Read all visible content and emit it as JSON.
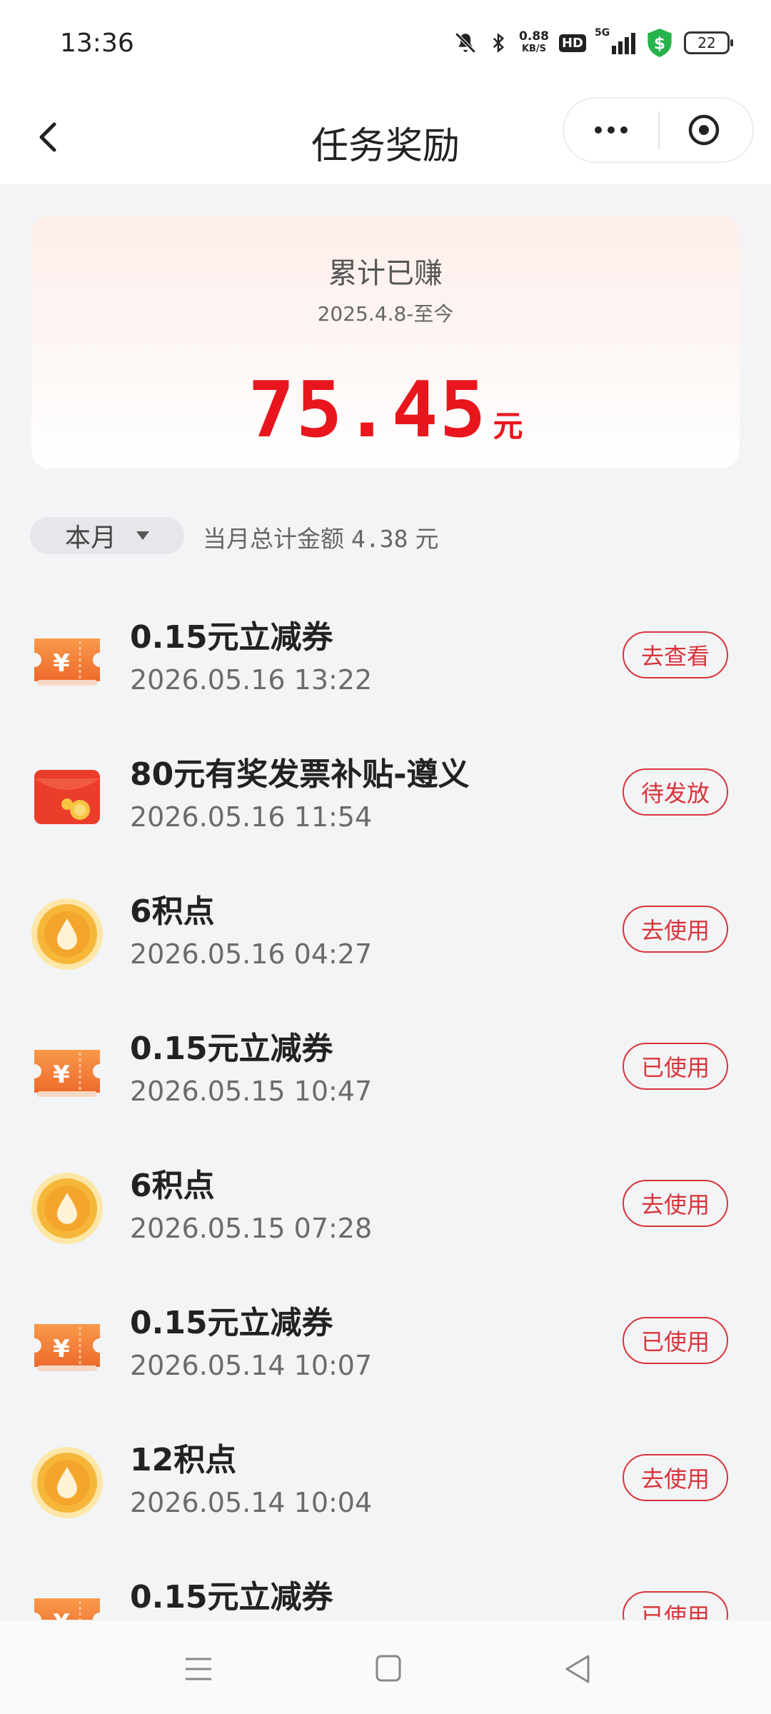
{
  "status_bar": {
    "time": "13:36",
    "speed_value": "0.88",
    "speed_unit": "KB/S",
    "hd_label": "HD",
    "network": "5G",
    "battery": "22",
    "icons": [
      "bell-off-icon",
      "bluetooth-icon",
      "hd-icon",
      "signal-icon",
      "shield-dollar-icon",
      "battery-icon"
    ]
  },
  "nav": {
    "title": "任务奖励",
    "back_icon": "chevron-left-icon",
    "more_icon": "more-dots-icon",
    "close_icon": "close-circle-icon"
  },
  "summary": {
    "title": "累计已赚",
    "range": "2025.4.8-至今",
    "amount": "75.45",
    "unit": "元"
  },
  "filter": {
    "month_label": "本月",
    "total_prefix": "当月总计金额",
    "total_value": "4.38",
    "total_unit": "元"
  },
  "rewards": [
    {
      "icon": "coupon-icon",
      "name": "0.15元立减券",
      "time": "2026.05.16 13:22",
      "action": "去查看"
    },
    {
      "icon": "red-envelope-icon",
      "name": "80元有奖发票补贴-遵义",
      "time": "2026.05.16 11:54",
      "action": "待发放"
    },
    {
      "icon": "points-coin-icon",
      "name": "6积点",
      "time": "2026.05.16 04:27",
      "action": "去使用"
    },
    {
      "icon": "coupon-icon",
      "name": "0.15元立减券",
      "time": "2026.05.15 10:47",
      "action": "已使用"
    },
    {
      "icon": "points-coin-icon",
      "name": "6积点",
      "time": "2026.05.15 07:28",
      "action": "去使用"
    },
    {
      "icon": "coupon-icon",
      "name": "0.15元立减券",
      "time": "2026.05.14 10:07",
      "action": "已使用"
    },
    {
      "icon": "points-coin-icon",
      "name": "12积点",
      "time": "2026.05.14 10:04",
      "action": "去使用"
    },
    {
      "icon": "coupon-icon",
      "name": "0.15元立减券",
      "time": "",
      "action": "已使用"
    }
  ],
  "colors": {
    "accent": "#e8161c",
    "button_border": "#d9343a",
    "background": "#f3f4f6",
    "coupon": "#f5863a",
    "coin": "#f6b63a"
  },
  "bottom_nav": {
    "icons": [
      "menu-icon",
      "home-square-icon",
      "back-triangle-icon"
    ]
  }
}
